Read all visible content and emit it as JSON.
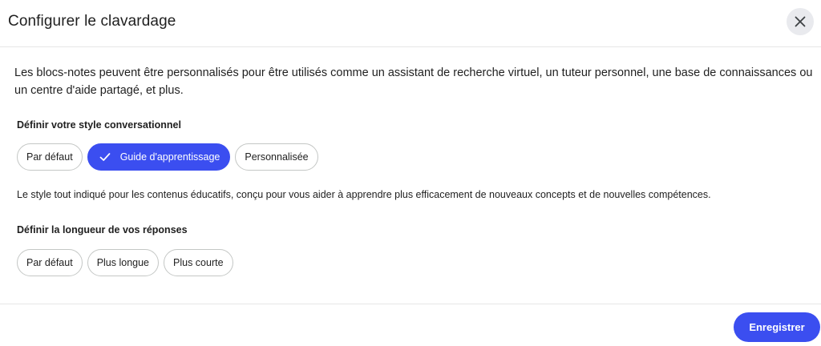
{
  "dialog": {
    "title": "Configurer le clavardage",
    "close_icon": "close-icon",
    "intro": "Les blocs-notes peuvent être personnalisés pour être utilisés comme un assistant de recherche virtuel, un tuteur personnel, une base de connaissances ou un centre d'aide partagé, et plus."
  },
  "style_section": {
    "label": "Définir votre style conversationnel",
    "options": [
      {
        "label": "Par défaut",
        "selected": false
      },
      {
        "label": "Guide d'apprentissage",
        "selected": true,
        "icon": "check-icon"
      },
      {
        "label": "Personnalisée",
        "selected": false
      }
    ],
    "description": "Le style tout indiqué pour les contenus éducatifs, conçu pour vous aider à apprendre plus efficacement de nouveaux concepts et de nouvelles compétences."
  },
  "length_section": {
    "label": "Définir la longueur de vos réponses",
    "options": [
      {
        "label": "Par défaut",
        "selected": false
      },
      {
        "label": "Plus longue",
        "selected": false
      },
      {
        "label": "Plus courte",
        "selected": false
      }
    ]
  },
  "footer": {
    "save_label": "Enregistrer"
  },
  "colors": {
    "accent": "#3b4ef0",
    "close_bg": "#e9eaee",
    "chip_border": "#c4c7c5"
  }
}
